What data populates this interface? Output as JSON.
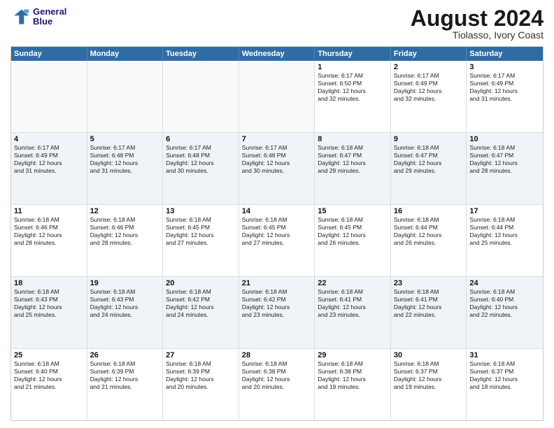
{
  "logo": {
    "line1": "General",
    "line2": "Blue"
  },
  "title": "August 2024",
  "subtitle": "Tiolasso, Ivory Coast",
  "header_days": [
    "Sunday",
    "Monday",
    "Tuesday",
    "Wednesday",
    "Thursday",
    "Friday",
    "Saturday"
  ],
  "weeks": [
    [
      {
        "day": "",
        "text": "",
        "empty": true
      },
      {
        "day": "",
        "text": "",
        "empty": true
      },
      {
        "day": "",
        "text": "",
        "empty": true
      },
      {
        "day": "",
        "text": "",
        "empty": true
      },
      {
        "day": "1",
        "text": "Sunrise: 6:17 AM\nSunset: 6:50 PM\nDaylight: 12 hours\nand 32 minutes."
      },
      {
        "day": "2",
        "text": "Sunrise: 6:17 AM\nSunset: 6:49 PM\nDaylight: 12 hours\nand 32 minutes."
      },
      {
        "day": "3",
        "text": "Sunrise: 6:17 AM\nSunset: 6:49 PM\nDaylight: 12 hours\nand 31 minutes."
      }
    ],
    [
      {
        "day": "4",
        "text": "Sunrise: 6:17 AM\nSunset: 6:49 PM\nDaylight: 12 hours\nand 31 minutes."
      },
      {
        "day": "5",
        "text": "Sunrise: 6:17 AM\nSunset: 6:48 PM\nDaylight: 12 hours\nand 31 minutes."
      },
      {
        "day": "6",
        "text": "Sunrise: 6:17 AM\nSunset: 6:48 PM\nDaylight: 12 hours\nand 30 minutes."
      },
      {
        "day": "7",
        "text": "Sunrise: 6:17 AM\nSunset: 6:48 PM\nDaylight: 12 hours\nand 30 minutes."
      },
      {
        "day": "8",
        "text": "Sunrise: 6:18 AM\nSunset: 6:47 PM\nDaylight: 12 hours\nand 29 minutes."
      },
      {
        "day": "9",
        "text": "Sunrise: 6:18 AM\nSunset: 6:47 PM\nDaylight: 12 hours\nand 29 minutes."
      },
      {
        "day": "10",
        "text": "Sunrise: 6:18 AM\nSunset: 6:47 PM\nDaylight: 12 hours\nand 28 minutes."
      }
    ],
    [
      {
        "day": "11",
        "text": "Sunrise: 6:18 AM\nSunset: 6:46 PM\nDaylight: 12 hours\nand 28 minutes."
      },
      {
        "day": "12",
        "text": "Sunrise: 6:18 AM\nSunset: 6:46 PM\nDaylight: 12 hours\nand 28 minutes."
      },
      {
        "day": "13",
        "text": "Sunrise: 6:18 AM\nSunset: 6:45 PM\nDaylight: 12 hours\nand 27 minutes."
      },
      {
        "day": "14",
        "text": "Sunrise: 6:18 AM\nSunset: 6:45 PM\nDaylight: 12 hours\nand 27 minutes."
      },
      {
        "day": "15",
        "text": "Sunrise: 6:18 AM\nSunset: 6:45 PM\nDaylight: 12 hours\nand 26 minutes."
      },
      {
        "day": "16",
        "text": "Sunrise: 6:18 AM\nSunset: 6:44 PM\nDaylight: 12 hours\nand 26 minutes."
      },
      {
        "day": "17",
        "text": "Sunrise: 6:18 AM\nSunset: 6:44 PM\nDaylight: 12 hours\nand 25 minutes."
      }
    ],
    [
      {
        "day": "18",
        "text": "Sunrise: 6:18 AM\nSunset: 6:43 PM\nDaylight: 12 hours\nand 25 minutes."
      },
      {
        "day": "19",
        "text": "Sunrise: 6:18 AM\nSunset: 6:43 PM\nDaylight: 12 hours\nand 24 minutes."
      },
      {
        "day": "20",
        "text": "Sunrise: 6:18 AM\nSunset: 6:42 PM\nDaylight: 12 hours\nand 24 minutes."
      },
      {
        "day": "21",
        "text": "Sunrise: 6:18 AM\nSunset: 6:42 PM\nDaylight: 12 hours\nand 23 minutes."
      },
      {
        "day": "22",
        "text": "Sunrise: 6:18 AM\nSunset: 6:41 PM\nDaylight: 12 hours\nand 23 minutes."
      },
      {
        "day": "23",
        "text": "Sunrise: 6:18 AM\nSunset: 6:41 PM\nDaylight: 12 hours\nand 22 minutes."
      },
      {
        "day": "24",
        "text": "Sunrise: 6:18 AM\nSunset: 6:40 PM\nDaylight: 12 hours\nand 22 minutes."
      }
    ],
    [
      {
        "day": "25",
        "text": "Sunrise: 6:18 AM\nSunset: 6:40 PM\nDaylight: 12 hours\nand 21 minutes."
      },
      {
        "day": "26",
        "text": "Sunrise: 6:18 AM\nSunset: 6:39 PM\nDaylight: 12 hours\nand 21 minutes."
      },
      {
        "day": "27",
        "text": "Sunrise: 6:18 AM\nSunset: 6:39 PM\nDaylight: 12 hours\nand 20 minutes."
      },
      {
        "day": "28",
        "text": "Sunrise: 6:18 AM\nSunset: 6:38 PM\nDaylight: 12 hours\nand 20 minutes."
      },
      {
        "day": "29",
        "text": "Sunrise: 6:18 AM\nSunset: 6:38 PM\nDaylight: 12 hours\nand 19 minutes."
      },
      {
        "day": "30",
        "text": "Sunrise: 6:18 AM\nSunset: 6:37 PM\nDaylight: 12 hours\nand 19 minutes."
      },
      {
        "day": "31",
        "text": "Sunrise: 6:18 AM\nSunset: 6:37 PM\nDaylight: 12 hours\nand 18 minutes."
      }
    ]
  ]
}
